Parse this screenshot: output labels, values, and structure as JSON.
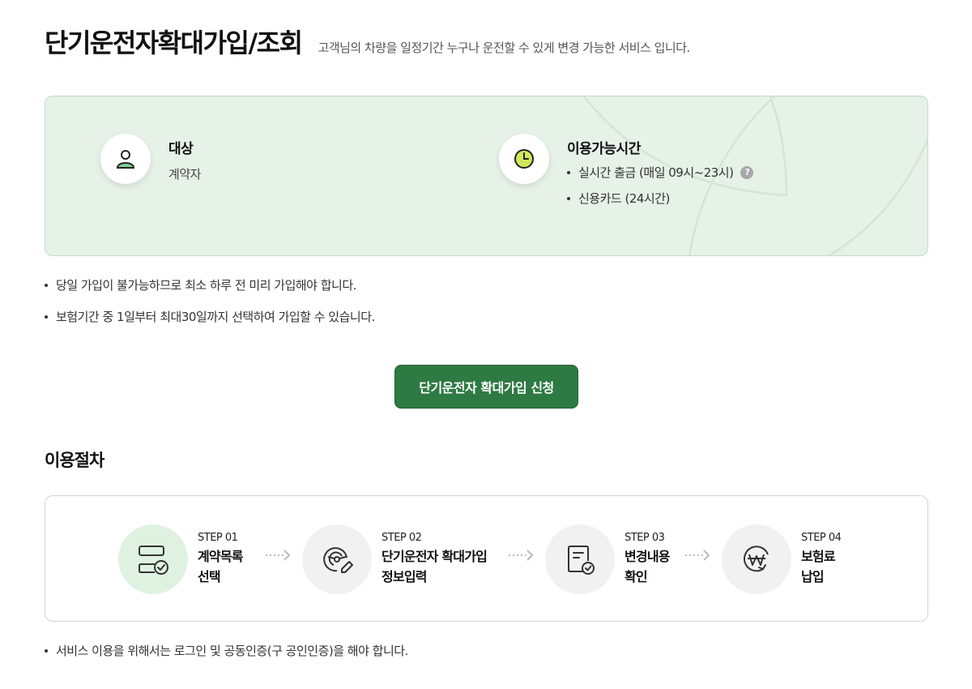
{
  "header": {
    "title": "단기운전자확대가입/조회",
    "description": "고객님의 차량을 일정기간 누구나 운전할 수 있게 변경 가능한 서비스 입니다."
  },
  "info": {
    "target": {
      "title": "대상",
      "value": "계약자",
      "icon": "person-icon"
    },
    "hours": {
      "title": "이용가능시간",
      "icon": "clock-icon",
      "items": [
        "실시간 출금 (매일 09시~23시)",
        "신용카드 (24시간)"
      ],
      "help_icon": "?"
    }
  },
  "notes": [
    "당일 가입이 불가능하므로 최소 하루 전 미리 가입해야 합니다.",
    "보험기간 중 1일부터 최대30일까지 선택하여 가입할 수 있습니다."
  ],
  "apply_button": "단기운전자 확대가입 신청",
  "procedure": {
    "title": "이용절차",
    "steps": [
      {
        "num": "STEP 01",
        "line1": "계약목록",
        "line2": "선택",
        "icon": "contract-list-icon"
      },
      {
        "num": "STEP 02",
        "line1": "단기운전자 확대가입",
        "line2": "정보입력",
        "icon": "steering-wheel-icon"
      },
      {
        "num": "STEP 03",
        "line1": "변경내용",
        "line2": "확인",
        "icon": "document-check-icon"
      },
      {
        "num": "STEP 04",
        "line1": "보험료",
        "line2": "납입",
        "icon": "won-payment-icon"
      }
    ]
  },
  "bottom_note": "서비스 이용을 위해서는 로그인 및 공동인증(구 공인인증)을 해야 합니다.",
  "colors": {
    "primary": "#2e7a43",
    "info_bg": "#e6f1e7",
    "active_step": "#dff2e2"
  }
}
